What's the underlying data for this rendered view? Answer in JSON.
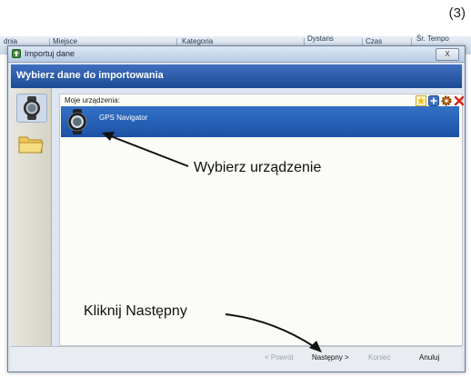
{
  "step_label": "(3)",
  "background": {
    "columns": [
      "dnia",
      "Miejsce",
      "Kategoria",
      "Dystans",
      "Czas",
      "Śr. Tempo"
    ]
  },
  "window": {
    "title": "Importuj dane",
    "close_label": "X",
    "header_title": "Wybierz dane do importowania",
    "sidebar": [
      {
        "icon": "watch-device-icon",
        "active": true
      },
      {
        "icon": "folder-icon",
        "active": false
      }
    ],
    "panel": {
      "label": "Moje urządzenia:",
      "toolbar": [
        "star-icon",
        "add-device-icon",
        "settings-gear-icon",
        "delete-x-icon"
      ],
      "devices": [
        {
          "name": "GPS Navigator",
          "icon": "watch-device-icon",
          "selected": true
        }
      ]
    },
    "footer": {
      "back": "< Powrót",
      "next": "Następny >",
      "finish": "Koniec",
      "cancel": "Anuluj"
    }
  },
  "annotations": {
    "select_device": "Wybierz urządzenie",
    "click_next": "Kliknij Następny"
  },
  "colors": {
    "header_blue": "#1c4b95",
    "selection_blue": "#2662b8"
  }
}
